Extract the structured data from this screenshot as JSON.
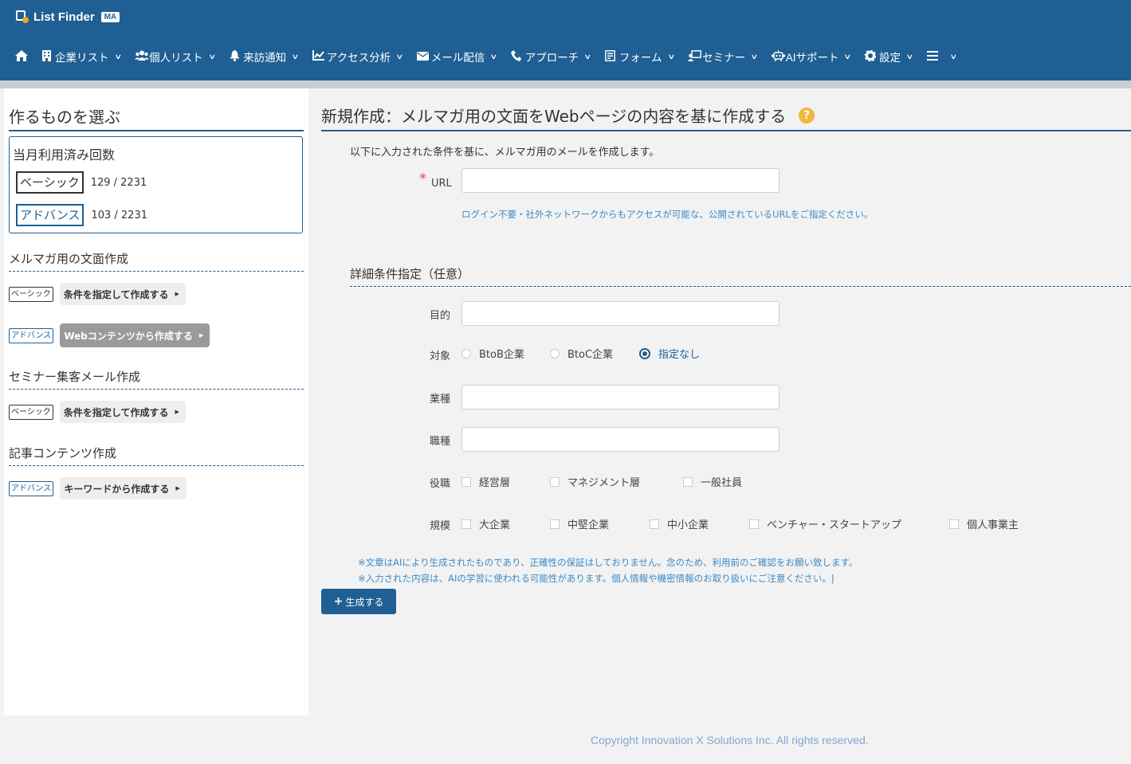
{
  "header": {
    "logo_text": "List Finder",
    "logo_badge": "MA",
    "nav": [
      {
        "icon": "home-icon",
        "glyph": "⌂",
        "label": ""
      },
      {
        "icon": "building-icon",
        "glyph": "▦",
        "label": "企業リスト"
      },
      {
        "icon": "users-icon",
        "glyph": "👥",
        "label": "個人リスト"
      },
      {
        "icon": "bell-icon",
        "glyph": "🔔",
        "label": "来訪通知"
      },
      {
        "icon": "chart-line-icon",
        "glyph": "📈",
        "label": "アクセス分析"
      },
      {
        "icon": "envelope-icon",
        "glyph": "✉",
        "label": "メール配信"
      },
      {
        "icon": "phone-icon",
        "glyph": "✆",
        "label": "アプローチ"
      },
      {
        "icon": "form-icon",
        "glyph": "▤",
        "label": "フォーム"
      },
      {
        "icon": "seminar-icon",
        "glyph": "▣",
        "label": "セミナー"
      },
      {
        "icon": "ai-robot-icon",
        "glyph": "☊",
        "label": "AIサポート"
      },
      {
        "icon": "gear-icon",
        "glyph": "⚙",
        "label": "設定"
      },
      {
        "icon": "menu-icon",
        "glyph": "☰",
        "label": ""
      }
    ]
  },
  "sidebar": {
    "title": "作るものを選ぶ",
    "usage": {
      "title": "当月利用済み回数",
      "basic_label": "ベーシック",
      "basic_count": "129 / 2231",
      "advance_label": "アドバンス",
      "advance_count": "103 / 2231"
    },
    "sections": [
      {
        "title": "メルマガ用の文面作成"
      },
      {
        "title": "セミナー集客メール作成"
      },
      {
        "title": "記事コンテンツ作成"
      }
    ],
    "tag_basic": "ベーシック",
    "tag_advance": "アドバンス",
    "options": {
      "mm_basic": "条件を指定して作成する",
      "mm_advance": "Webコンテンツから作成する",
      "seminar_basic": "条件を指定して作成する",
      "article_advance": "キーワードから作成する"
    }
  },
  "main": {
    "title": "新規作成：メルマガ用の文面をWebページの内容を基に作成する",
    "help": "?",
    "intro": "以下に入力された条件を基に、メルマガ用のメールを作成します。",
    "required_mark": "*",
    "url_label": "URL",
    "url_value": "",
    "url_hint": "ログイン不要・社外ネットワークからもアクセスが可能な、公開されているURLをご指定ください。",
    "detail_title": "詳細条件指定（任意）",
    "purpose_label": "目的",
    "purpose_value": "",
    "target_label": "対象",
    "target_options": [
      "BtoB企業",
      "BtoC企業",
      "指定なし"
    ],
    "target_selected": "指定なし",
    "industry_label": "業種",
    "industry_value": "",
    "job_label": "職種",
    "job_value": "",
    "position_label": "役職",
    "position_options": [
      "経営層",
      "マネジメント層",
      "一般社員"
    ],
    "scale_label": "規模",
    "scale_options": [
      "大企業",
      "中堅企業",
      "中小企業",
      "ベンチャー・スタートアップ",
      "個人事業主"
    ],
    "notes": [
      "※文章はAIにより生成されたものであり、正確性の保証はしておりません。念のため、利用前のご確認をお願い致します。",
      "※入力された内容は、AIの学習に使われる可能性があります。個人情報や機密情報のお取り扱いにご注意ください。|"
    ],
    "generate_icon": "+",
    "generate_label": "生成する"
  },
  "footer": {
    "copyright": "Copyright Innovation X Solutions Inc. All rights reserved."
  },
  "colors": {
    "header_bg": "#1f5f94",
    "accent": "#1f5f94",
    "hint": "#3c8ac6",
    "required": "#d9534f",
    "help": "#f3b63d"
  }
}
